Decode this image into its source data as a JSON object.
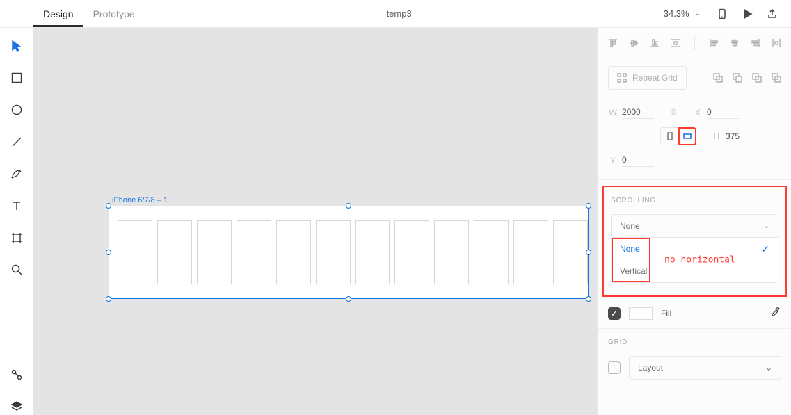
{
  "header": {
    "tabs": {
      "design": "Design",
      "prototype": "Prototype"
    },
    "document_title": "temp3",
    "zoom": "34.3%"
  },
  "canvas": {
    "artboard_label": "iPhone 6/7/8 – 1"
  },
  "inspector": {
    "repeat_grid_label": "Repeat Grid",
    "transform": {
      "w_label": "W",
      "w_value": "2000",
      "h_label": "H",
      "h_value": "375",
      "x_label": "X",
      "x_value": "0",
      "y_label": "Y",
      "y_value": "0"
    },
    "scrolling": {
      "title": "SCROLLING",
      "selected": "None",
      "options": {
        "none": "None",
        "vertical": "Vertical"
      },
      "annotation": "no horizontal"
    },
    "fill": {
      "label": "Fill"
    },
    "grid": {
      "title": "GRID",
      "selected": "Layout"
    }
  }
}
